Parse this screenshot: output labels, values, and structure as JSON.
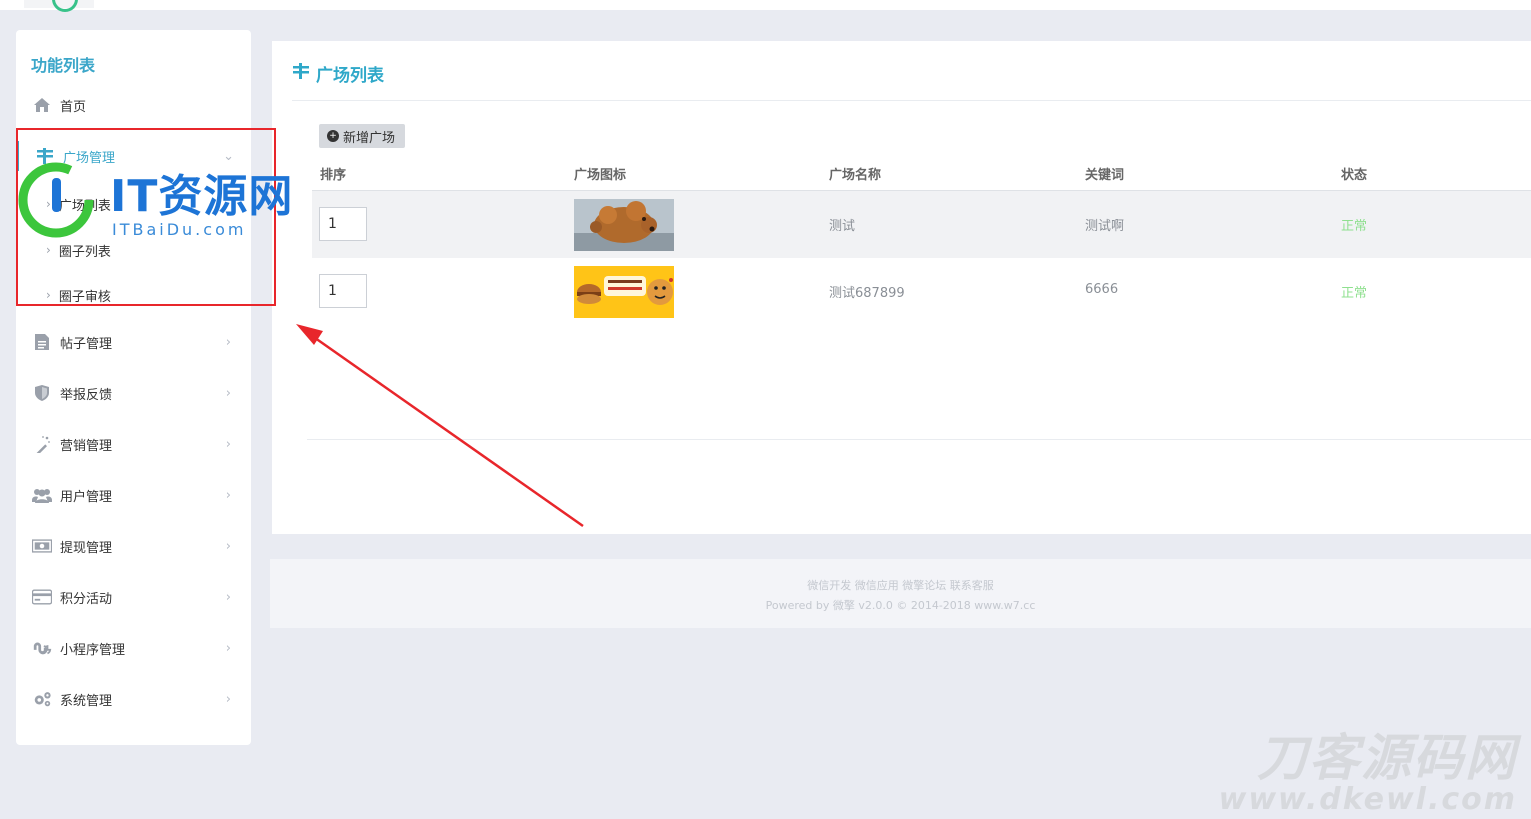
{
  "sidebar": {
    "title": "功能列表",
    "items": [
      {
        "label": "首页",
        "icon": "home-icon"
      },
      {
        "label": "广场管理",
        "icon": "list-icon"
      },
      {
        "label": "帖子管理",
        "icon": "document-icon"
      },
      {
        "label": "举报反馈",
        "icon": "shield-icon"
      },
      {
        "label": "营销管理",
        "icon": "magic-wand-icon"
      },
      {
        "label": "用户管理",
        "icon": "users-icon"
      },
      {
        "label": "提现管理",
        "icon": "money-icon"
      },
      {
        "label": "积分活动",
        "icon": "credit-card-icon"
      },
      {
        "label": "小程序管理",
        "icon": "stumbleupon-icon"
      },
      {
        "label": "系统管理",
        "icon": "gears-icon"
      }
    ],
    "subitems": [
      {
        "label": "广场列表"
      },
      {
        "label": "圈子列表"
      },
      {
        "label": "圈子审核"
      }
    ]
  },
  "main": {
    "title": "广场列表",
    "add_button": "新增广场",
    "columns": [
      "排序",
      "广场图标",
      "广场名称",
      "关键词",
      "状态"
    ],
    "rows": [
      {
        "sort": "1",
        "name": "测试",
        "keyword": "测试啊",
        "status": "正常",
        "icon": "poodle-photo"
      },
      {
        "sort": "1",
        "name": "测试687899",
        "keyword": "6666",
        "status": "正常",
        "icon": "burger-cartoon-banner"
      }
    ]
  },
  "footer": {
    "links": "微信开发 微信应用 微擎论坛 联系客服",
    "powered": "Powered by 微擎 v2.0.0 © 2014-2018 www.w7.cc"
  },
  "watermarks": {
    "it_main": "IT资源网",
    "it_sub": "ITBaiDu.com",
    "dk_main": "刀客源码网",
    "dk_sub": "www.dkewl.com"
  },
  "colors": {
    "accent": "#2fa8c9",
    "status_ok": "#8fe08f",
    "annotation": "#e8262b"
  }
}
